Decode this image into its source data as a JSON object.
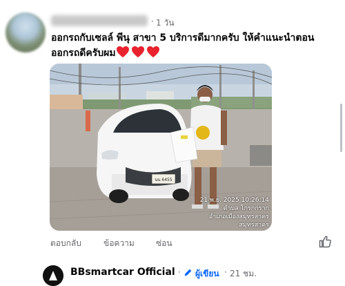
{
  "comment": {
    "author_blurred": "",
    "separator": "·",
    "time": "1 วัน",
    "text_line1": "ออกรถกับเซลล์ พีนุ สาขา 5 บริการดีมากครับ  ให้คำแนะนำตอน",
    "text_line2": "ออกรถดีครับผม",
    "hearts": [
      "heart-emoji",
      "heart-emoji",
      "heart-emoji"
    ],
    "photo": {
      "timestamp": "21 พ.ย. 2025 10:26:14",
      "location_line1": "ตำบล โกรกกราก",
      "location_line2": "อำเภอเมืองสมุทรสาคร",
      "location_line3": "สมุทรสาคร",
      "plate": "นน 6455"
    },
    "actions": {
      "reply": "ตอบกลับ",
      "message": "ข้อความ",
      "hide": "ซ่อน"
    },
    "icons": {
      "like": "thumbs-up-icon"
    }
  },
  "reply": {
    "author": "BBsmartcar Official",
    "separator": "·",
    "badge": "ผู้เขียน",
    "separator2": "·",
    "time": "21 ชม.",
    "icons": {
      "badge": "pen-icon"
    }
  },
  "colors": {
    "text": "#050505",
    "secondary": "#65676b",
    "accent": "#0866ff",
    "heart": "#e8232e"
  }
}
